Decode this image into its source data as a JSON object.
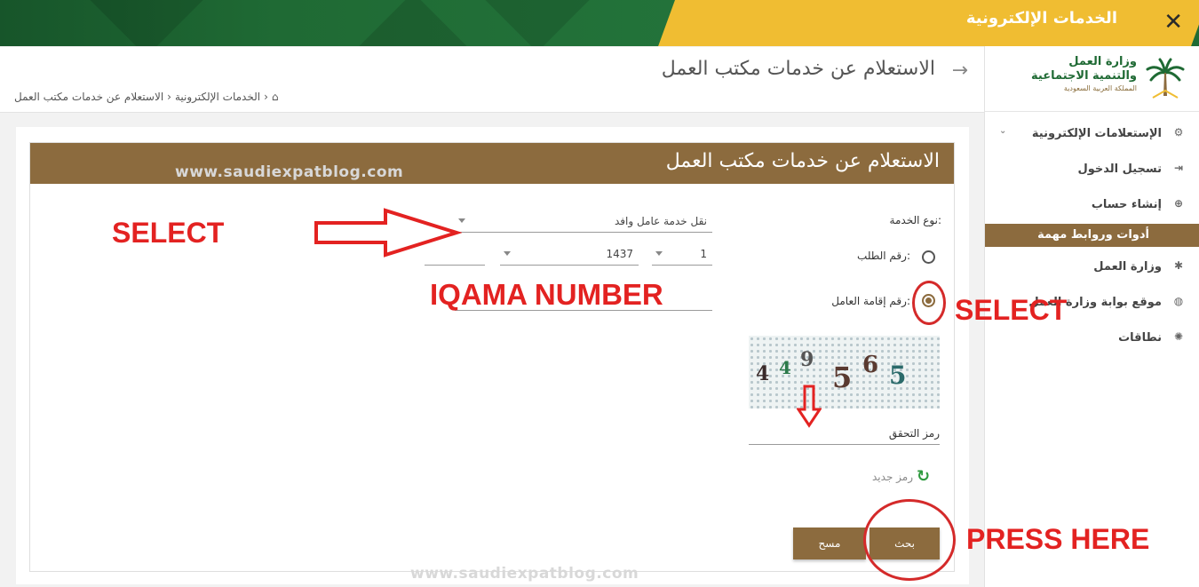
{
  "header": {
    "title": "الخدمات الإلكترونية",
    "close_icon": "close-icon"
  },
  "brand": {
    "name_line1": "وزارة العمل",
    "name_line2": "والتنمية الاجتماعية",
    "country": "المملكة العربية السعودية"
  },
  "sidebar": {
    "items": [
      {
        "label": "الإستعلامات الإلكترونية",
        "icon": "cogs-icon"
      },
      {
        "label": "تسجيل الدخول",
        "icon": "sign-in-icon"
      },
      {
        "label": "إنشاء حساب",
        "icon": "plus-circle-icon"
      }
    ],
    "section_label": "أدوات وروابط مهمة",
    "links": [
      {
        "label": "وزارة العمل",
        "icon": "palm-icon"
      },
      {
        "label": "موقع بوابة وزارة العمل",
        "icon": "globe-icon"
      },
      {
        "label": "نطاقات",
        "icon": "nitaqat-icon"
      }
    ]
  },
  "page": {
    "title": "الاستعلام عن خدمات مكتب العمل",
    "breadcrumb": [
      "الخدمات الإلكترونية",
      "الاستعلام عن خدمات مكتب العمل"
    ]
  },
  "form": {
    "heading": "الاستعلام عن خدمات مكتب العمل",
    "service_type_label": "نوع الخدمة:",
    "service_type_value": "نقل خدمة عامل وافد",
    "request_number_label": "رقم الطلب:",
    "request_number_value": "1",
    "request_year_value": "1437",
    "iqama_label": "رقم إقامة العامل:",
    "captcha_label": "رمز التحقق",
    "captcha_text": [
      "4",
      "4",
      "9",
      "5",
      "6",
      "5"
    ],
    "refresh_label": "رمز جديد",
    "search_button": "بحث",
    "clear_button": "مسح"
  },
  "annotations": {
    "watermark": "www.saudiexpatblog.com",
    "select_left": "SELECT",
    "iqama": "IQAMA NUMBER",
    "select_right": "SELECT",
    "press": "PRESS HERE"
  },
  "colors": {
    "brand_green": "#1f6a34",
    "accent_gold": "#f0bd32",
    "brand_brown": "#8c6b3e",
    "annotation_red": "#e32221"
  }
}
